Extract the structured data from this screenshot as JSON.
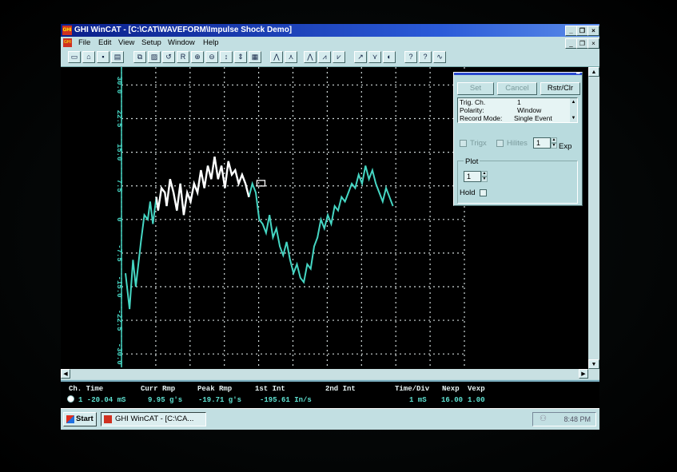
{
  "window": {
    "title": "GHI WinCAT - [C:\\CAT\\WAVEFORM\\Impulse Shock Demo]",
    "icon": "ghi-logo-icon",
    "controls": [
      "_",
      "❐",
      "×"
    ],
    "doc_controls": [
      "_",
      "❐",
      "×"
    ]
  },
  "menu": {
    "items": [
      "File",
      "Edit",
      "View",
      "Setup",
      "Window",
      "Help"
    ]
  },
  "toolbar": {
    "buttons": [
      "new-icon",
      "open-icon",
      "save-icon",
      "print-icon",
      "copy-icon",
      "paste-icon",
      "undo-icon",
      "r-icon",
      "zoom-in-icon",
      "zoom-out-icon",
      "scroll-icon",
      "fit-icon",
      "grid-icon",
      "cursor-a-icon",
      "cursor-b-icon",
      "peak-icon",
      "rise-icon",
      "fall-icon",
      "measure-icon",
      "filter-icon",
      "trigger-icon",
      "help-icon",
      "context-help-icon",
      "scope-icon"
    ]
  },
  "plot": {
    "y_ticks": [
      "30.0",
      "22.5",
      "15.0",
      "7.5",
      "0",
      "-7.5",
      "-15.0",
      "-22.5",
      "-30.0"
    ],
    "ylim": [
      -33,
      34
    ],
    "trace_color": "#45d6c3",
    "cursor_trace_color": "#ffffff"
  },
  "trigger_panel": {
    "set_label": "Set",
    "cancel_label": "Cancel",
    "rstr_label": "Rstr/Clr",
    "rows": [
      {
        "label": "Trig. Ch.",
        "value": "1"
      },
      {
        "label": "Polarity:",
        "value": "Window"
      },
      {
        "label": "Record Mode:",
        "value": "Single Event"
      }
    ],
    "trigx_label": "Trigx",
    "hilites_label": "Hilites",
    "exp_value": "1",
    "exp_label": "Exp",
    "plot_label": "Plot",
    "plot_value": "1",
    "hold_label": "Hold"
  },
  "status": {
    "headers": [
      "Ch. Time",
      "Curr Rmp",
      "Peak Rmp",
      "1st Int",
      "2nd Int",
      "Time/Div",
      "Nexp",
      "Vexp"
    ],
    "values": [
      "1 -20.04 mS",
      "9.95 g's",
      "-19.71 g's",
      "-195.61 In/s",
      "",
      "1 mS",
      "16.00",
      "1.00"
    ]
  },
  "taskbar": {
    "start_label": "Start",
    "task_label": "GHI WinCAT - [C:\\CA...",
    "clock": "8:48 PM"
  }
}
